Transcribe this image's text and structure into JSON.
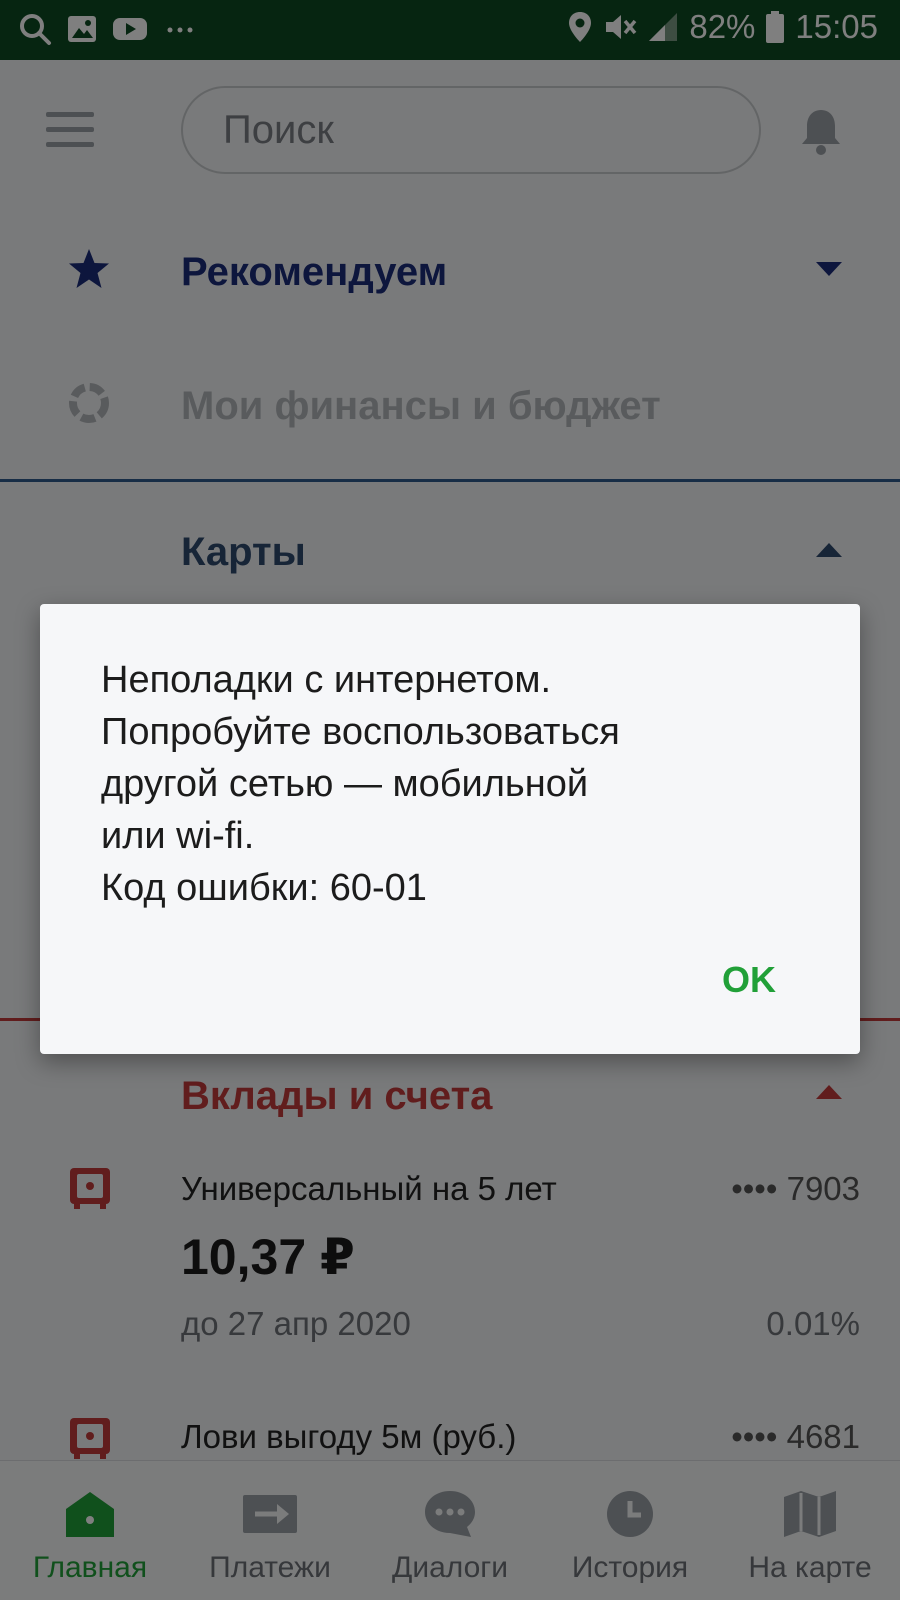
{
  "status_bar": {
    "battery": "82%",
    "time": "15:05",
    "left_icons": [
      "search-icon",
      "gallery-icon",
      "youtube-icon",
      "more-dots-icon"
    ],
    "right_icons": [
      "location-icon",
      "mute-icon",
      "signal-icon",
      "battery-icon"
    ]
  },
  "header": {
    "search_placeholder": "Поиск"
  },
  "sections": {
    "recommended": {
      "title": "Рекомендуем",
      "icon": "star-icon",
      "color": "#1b2c7a"
    },
    "finances": {
      "title": "Мои финансы и бюджет",
      "icon": "ring-icon",
      "color": "#b3b7bb"
    },
    "cards": {
      "title": "Карты",
      "icon": "chevron-up-icon",
      "color": "#2e4a6e"
    },
    "deposits": {
      "title": "Вклады и счета",
      "color": "#c23b3b"
    }
  },
  "deposits": [
    {
      "name": "Универсальный на 5 лет",
      "number": "•••• 7903",
      "amount": "10,37 ₽",
      "date": "до 27 апр 2020",
      "rate": "0.01%"
    },
    {
      "name": "Лови выгоду 5м (руб.)",
      "number": "•••• 4681"
    }
  ],
  "bottom_nav": [
    {
      "label": "Главная",
      "icon": "home-icon",
      "active": true
    },
    {
      "label": "Платежи",
      "icon": "payments-icon",
      "active": false
    },
    {
      "label": "Диалоги",
      "icon": "dialogs-icon",
      "active": false
    },
    {
      "label": "История",
      "icon": "history-icon",
      "active": false
    },
    {
      "label": "На карте",
      "icon": "map-icon",
      "active": false
    }
  ],
  "dialog": {
    "lines": [
      "Неполадки с интернетом.",
      "Попробуйте воспользоваться",
      "другой сетью — мобильной",
      "или wi-fi.",
      "Код ошибки: 60-01"
    ],
    "ok_label": "OK"
  },
  "colors": {
    "status_bar": "#0d4a22",
    "accent_green": "#21a038",
    "deposit_red": "#c23b3b"
  }
}
